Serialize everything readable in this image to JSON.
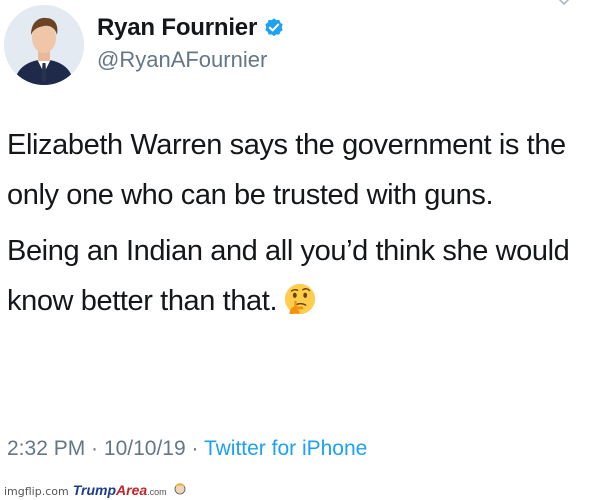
{
  "tweet": {
    "author_name": "Ryan Fournier",
    "author_handle": "@RyanAFournier",
    "paragraphs": [
      "Elizabeth Warren says the government is the only one who can be trusted with guns.",
      "Being an Indian and all you’d think she would know better than that."
    ],
    "emoji": "thinking-face",
    "time": "2:32 PM",
    "separator": " · ",
    "date": "10/10/19",
    "source": "Twitter for iPhone"
  },
  "watermark": {
    "imgflip": "imgflip.com",
    "trump": "Trump",
    "area": "Area",
    "com": ".com"
  },
  "colors": {
    "verified": "#1da1f2",
    "link": "#1da1f2",
    "secondary_text": "#657786",
    "primary_text": "#14171a"
  }
}
